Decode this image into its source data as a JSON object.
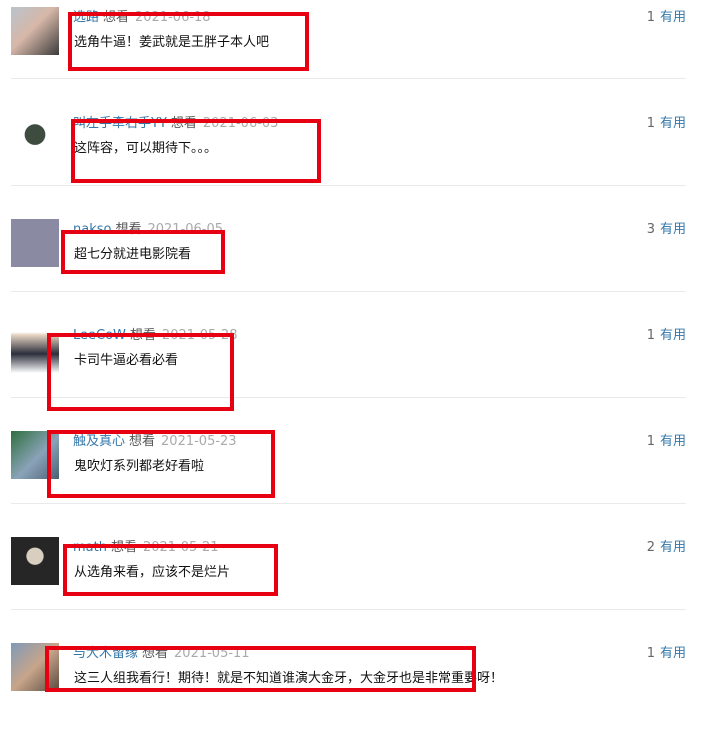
{
  "comments": [
    {
      "user": "选路",
      "action": "想看",
      "date": "2021-06-18",
      "text": "选角牛逼！姜武就是王胖子本人吧",
      "vote_count": "1",
      "vote_label": "有用"
    },
    {
      "user": "叫左手牵右手YY",
      "action": "想看",
      "date": "2021-06-03",
      "text": "这阵容，可以期待下。。。",
      "vote_count": "1",
      "vote_label": "有用"
    },
    {
      "user": "nakso",
      "action": "想看",
      "date": "2021-06-05",
      "text": "超七分就进电影院看",
      "vote_count": "3",
      "vote_label": "有用"
    },
    {
      "user": "LeeCoW",
      "action": "想看",
      "date": "2021-05-28",
      "text": "卡司牛逼必看必看",
      "vote_count": "1",
      "vote_label": "有用"
    },
    {
      "user": "触及真心",
      "action": "想看",
      "date": "2021-05-23",
      "text": "鬼吹灯系列都老好看啦",
      "vote_count": "1",
      "vote_label": "有用"
    },
    {
      "user": "math",
      "action": "想看",
      "date": "2021-05-21",
      "text": "从选角来看，应该不是烂片",
      "vote_count": "2",
      "vote_label": "有用"
    },
    {
      "user": "与大木留缘",
      "action": "想看",
      "date": "2021-05-11",
      "text": "这三人组我看行！期待！就是不知道谁演大金牙，大金牙也是非常重要呀！",
      "vote_count": "1",
      "vote_label": "有用"
    }
  ],
  "highlight_color": "#e60012"
}
